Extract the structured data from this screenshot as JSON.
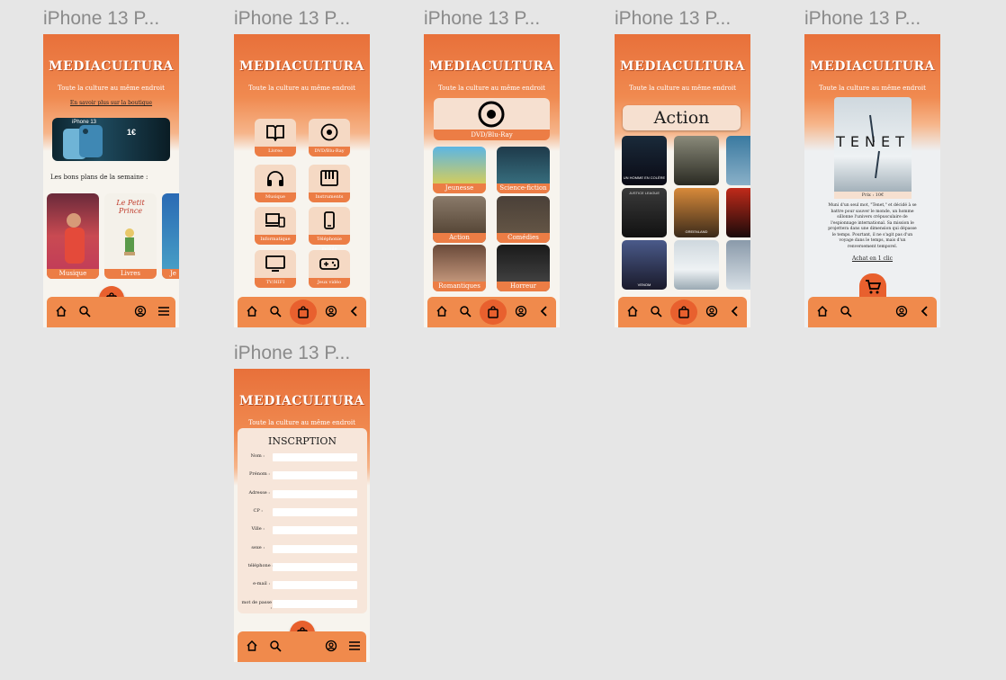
{
  "frame_labels": [
    "iPhone 13 P...",
    "iPhone 13 P...",
    "iPhone 13 P...",
    "iPhone 13 P...",
    "iPhone 13 P...",
    "iPhone 13 P..."
  ],
  "brand": {
    "name": "MEDIACULTURA",
    "tagline": "Toute la culture au même endroit"
  },
  "home": {
    "link": "En savoir plus sur la boutique",
    "ad_brand": "iPhone 13",
    "ad_price": "1€",
    "section_title": "Les bons plans de la semaine :",
    "cards": [
      "Musique",
      "Livres",
      "Je"
    ],
    "book_title": "Le Petit Prince"
  },
  "categories": {
    "tiles": [
      "Livres",
      "DVD/Blu-Ray",
      "Musique",
      "Instruments",
      "Informatique",
      "Téléphonie mobile",
      "TV/HIFI",
      "Jeux vidéo"
    ]
  },
  "dvd": {
    "title": "DVD/Blu-Ray",
    "genres": [
      "Jeunesse",
      "Science-fiction",
      "Action",
      "Comédies",
      "Romantiques",
      "Horreur"
    ]
  },
  "action": {
    "title": "Action",
    "poster_texts": [
      "UN HOMME EN COLÈRE",
      "JUSTICE LEAGUE",
      "GREENLAND",
      "VENOM"
    ]
  },
  "product": {
    "poster_text": "TENET",
    "price": "Prix : 10€",
    "synopsis": "Muni d'un seul mot, \"Tenet,\" et décidé à se battre pour sauver le monde, un homme sillonne l'univers crépusculaire de l'espionnage international. Sa mission le projettera dans une dimension qui dépasse le temps. Pourtant, il ne s'agit pas d'un voyage dans le temps, mais d'un renversement temporel.",
    "buy_link": "Achat en 1 clic"
  },
  "signup": {
    "title": "INSCRPTION",
    "fields": [
      "Nom :",
      "Prénom :",
      "Adresse :",
      "CP :",
      "Ville :",
      "sexe :",
      "téléphone :",
      "e-mail :",
      "mot de passe :"
    ]
  },
  "colors": {
    "accent": "#e8703a",
    "nav": "#f08a4c",
    "tile": "#f5d9c4",
    "label": "#ec7d45"
  }
}
